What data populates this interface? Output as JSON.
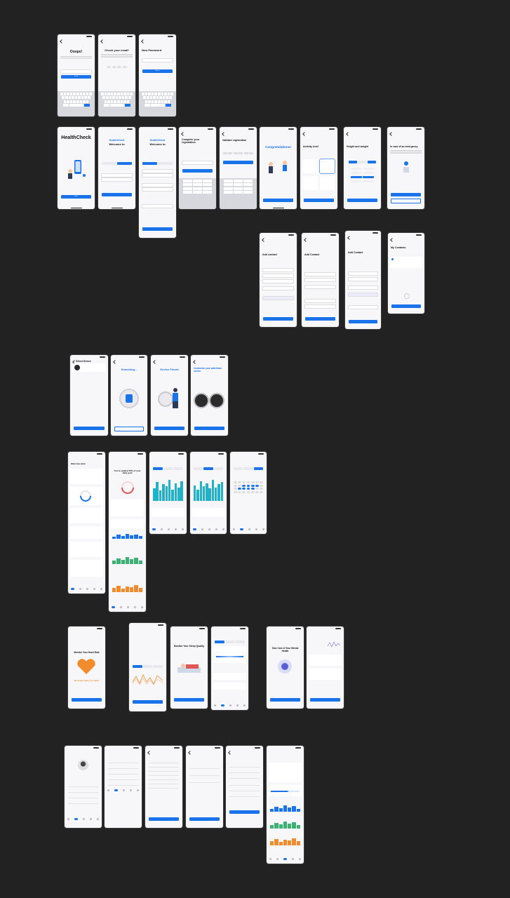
{
  "flow_auth": {
    "oops": {
      "title": "Ooops!",
      "button": "Send"
    },
    "check_email": {
      "title": "Check your email!"
    },
    "new_password": {
      "title": "New Password",
      "button": "Reset"
    }
  },
  "flow_onboarding": {
    "splash": {
      "title": "HealthCheck",
      "button": "Start"
    },
    "welcome1": {
      "brand": "HealthCheck",
      "title": "Welcome to"
    },
    "welcome2": {
      "brand": "HealthCheck",
      "title": "Welcome to"
    },
    "complete": {
      "title": "Complete your registration"
    },
    "validate": {
      "title": "Validate registration"
    },
    "congrats": {
      "title": "Congratulations!"
    },
    "activity": {
      "title": "Activity level"
    },
    "height_weight": {
      "title": "Height and weight"
    },
    "emergency": {
      "title": "In case of an emergency"
    }
  },
  "flow_contacts": {
    "add1": {
      "title": "Add contact"
    },
    "add2": {
      "title": "Add Contact"
    },
    "add3": {
      "title": "Add Contact"
    },
    "my": {
      "title": "My Contacts"
    }
  },
  "flow_device": {
    "select": {
      "title": "Select Device"
    },
    "searching": {
      "title": "Searching..."
    },
    "found": {
      "title": "Device Found"
    },
    "customize": {
      "title": "Customize your watchface screen"
    }
  },
  "flow_dashboard": {
    "home": {
      "title": "Welcome back"
    },
    "goal": {
      "title": "You've walked 50% of your daily goal"
    }
  },
  "flow_features": {
    "heart": {
      "title": "Monitor Your Heart Rate",
      "subtitle": "Be smart with your heart"
    },
    "sleep": {
      "title": "Monitor Your Sleep Quality"
    },
    "mental": {
      "title": "Take Care of Your Mental Health"
    }
  },
  "flow_profile": {}
}
